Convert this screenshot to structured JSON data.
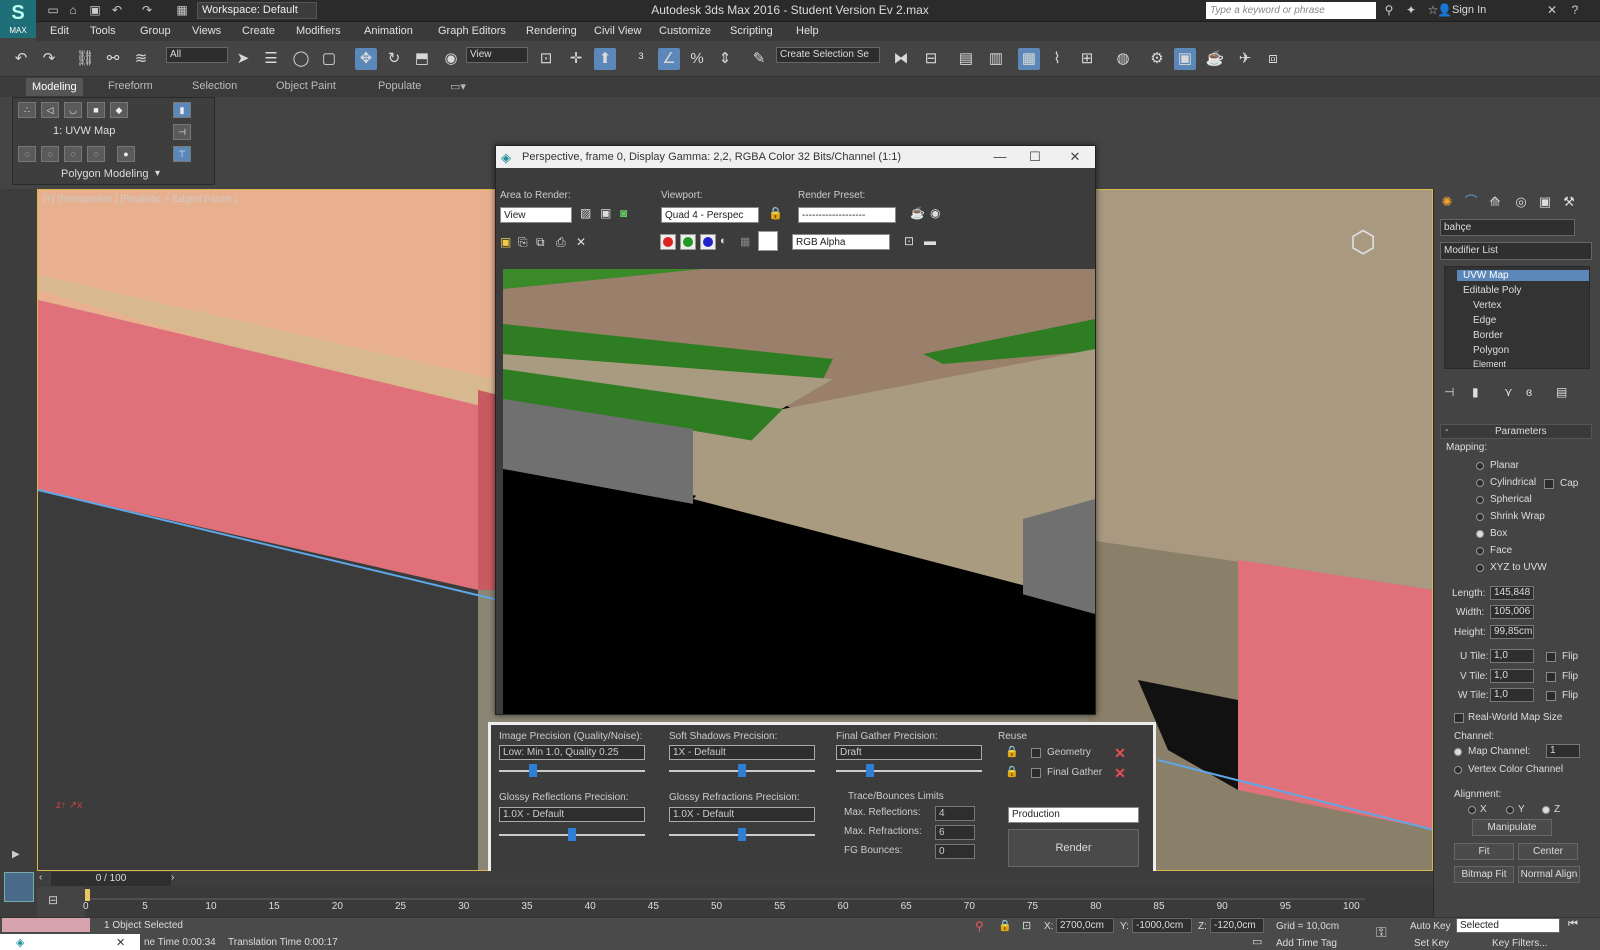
{
  "app": {
    "title": "Autodesk 3ds Max 2016 - Student Version    Ev 2.max",
    "logo_text": "MAX",
    "workspace": "Workspace: Default",
    "search_placeholder": "Type a keyword or phrase",
    "sign_in": "Sign In"
  },
  "menu": [
    "Edit",
    "Tools",
    "Group",
    "Views",
    "Create",
    "Modifiers",
    "Animation",
    "Graph Editors",
    "Rendering",
    "Civil View",
    "Customize",
    "Scripting",
    "Help"
  ],
  "toolbar": {
    "selection_filter": "All",
    "ref_coord": "View",
    "named_selection": "Create Selection Se"
  },
  "ribbon": {
    "tabs": [
      "Modeling",
      "Freeform",
      "Selection",
      "Object Paint",
      "Populate"
    ],
    "active_tab": "Modeling",
    "modifier_label": "1: UVW Map",
    "panel_label": "Polygon Modeling"
  },
  "viewport": {
    "label": "[+] [Perspective ] [Realistic + Edged Faces ]"
  },
  "render_window": {
    "title": "Perspective, frame 0, Display Gamma: 2,2, RGBA Color 32 Bits/Channel (1:1)",
    "area_label": "Area to Render:",
    "area_value": "View",
    "viewport_label": "Viewport:",
    "viewport_value": "Quad 4 - Perspec",
    "preset_label": "Render Preset:",
    "preset_value": "-------------------",
    "channel_value": "RGB Alpha"
  },
  "render_settings": {
    "image_precision_label": "Image Precision (Quality/Noise):",
    "image_precision_value": "Low: Min 1.0, Quality 0.25",
    "soft_shadows_label": "Soft Shadows Precision:",
    "soft_shadows_value": "1X - Default",
    "final_gather_label": "Final Gather Precision:",
    "final_gather_value": "Draft",
    "glossy_reflections_label": "Glossy Reflections Precision:",
    "glossy_reflections_value": "1.0X - Default",
    "glossy_refractions_label": "Glossy Refractions Precision:",
    "glossy_refractions_value": "1.0X - Default",
    "reuse_label": "Reuse",
    "reuse_geometry": "Geometry",
    "reuse_final_gather": "Final Gather",
    "trace_label": "Trace/Bounces Limits",
    "max_reflections_label": "Max. Reflections:",
    "max_reflections": "4",
    "max_refractions_label": "Max. Refractions:",
    "max_refractions": "6",
    "fg_bounces_label": "FG Bounces:",
    "fg_bounces": "0",
    "mode": "Production",
    "render_button": "Render",
    "slider_levels": {
      "image": 0.22,
      "soft": 0.5,
      "fg": 0.22,
      "glossy_refl": 0.5,
      "glossy_refr": 0.5
    }
  },
  "command_panel": {
    "object_name": "bahçe",
    "modifier_list": "Modifier List",
    "stack": [
      "UVW Map",
      "Editable Poly",
      "Vertex",
      "Edge",
      "Border",
      "Polygon",
      "Element"
    ],
    "parameters_title": "Parameters",
    "mapping_label": "Mapping:",
    "mapping_options": [
      "Planar",
      "Cylindrical",
      "Spherical",
      "Shrink Wrap",
      "Box",
      "Face",
      "XYZ to UVW"
    ],
    "mapping_selected": "Box",
    "cap_label": "Cap",
    "length_label": "Length:",
    "length": "145,848",
    "width_label": "Width:",
    "width": "105,006",
    "height_label": "Height:",
    "height": "99,85cm",
    "u_tile_label": "U Tile:",
    "u_tile": "1,0",
    "v_tile_label": "V Tile:",
    "v_tile": "1,0",
    "w_tile_label": "W Tile:",
    "w_tile": "1,0",
    "flip_label": "Flip",
    "real_world": "Real-World Map Size",
    "channel_label": "Channel:",
    "map_channel_label": "Map Channel:",
    "map_channel": "1",
    "vertex_color_channel": "Vertex Color Channel",
    "alignment_label": "Alignment:",
    "align_x": "X",
    "align_y": "Y",
    "align_z": "Z",
    "manipulate": "Manipulate",
    "fit": "Fit",
    "center": "Center",
    "bitmap_fit": "Bitmap Fit",
    "normal_align": "Normal Align"
  },
  "timeline": {
    "counter": "0 / 100",
    "ticks": [
      "0",
      "5",
      "10",
      "15",
      "20",
      "25",
      "30",
      "35",
      "40",
      "45",
      "50",
      "55",
      "60",
      "65",
      "70",
      "75",
      "80",
      "85",
      "90",
      "95",
      "100"
    ]
  },
  "status": {
    "selection": "1 Object Selected",
    "render_time": "ne Time  0:00:34",
    "translation_time": "Translation Time  0:00:17",
    "x_label": "X:",
    "x": "2700,0cm",
    "y_label": "Y:",
    "y": "-1000,0cm",
    "z_label": "Z:",
    "z": "-120,0cm",
    "grid": "Grid = 10,0cm",
    "auto_key": "Auto Key",
    "set_key": "Set Key",
    "key_mode": "Selected",
    "key_filters": "Key Filters...",
    "add_time_tag": "Add Time Tag"
  }
}
